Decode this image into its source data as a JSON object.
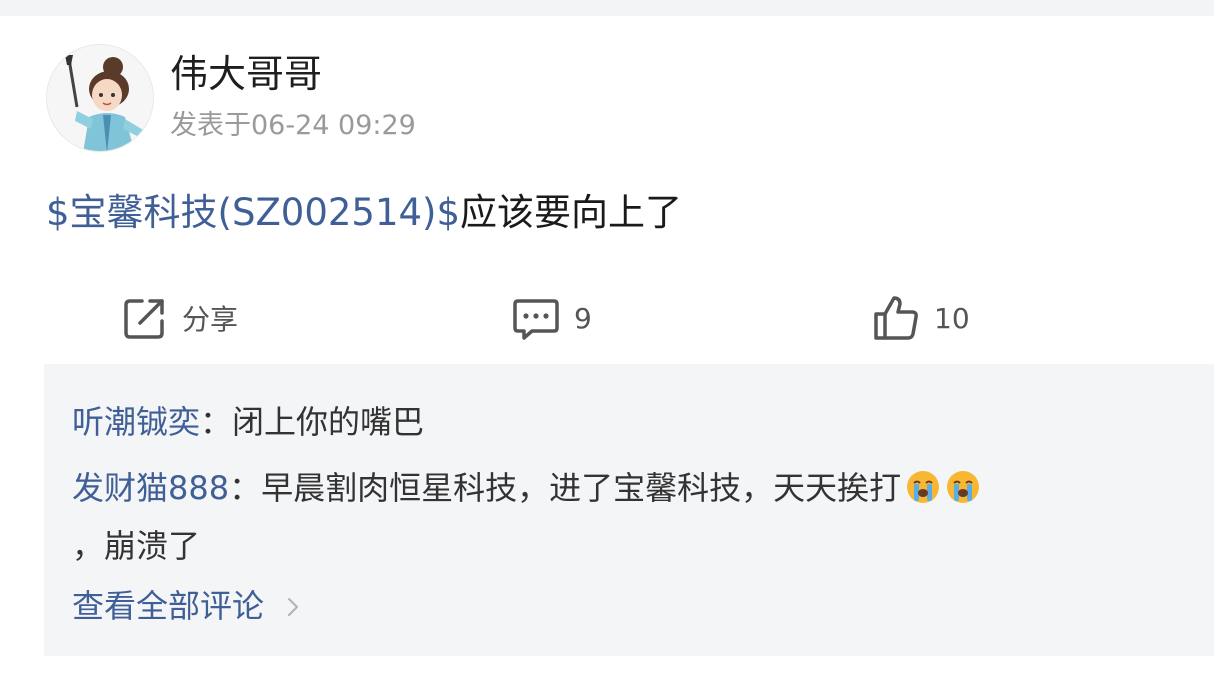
{
  "post": {
    "username": "伟大哥哥",
    "meta_prefix": "发表于",
    "timestamp": "06-24 09:29",
    "stock_link": "$宝馨科技(SZ002514)$",
    "content": "应该要向上了"
  },
  "actions": {
    "share_label": "分享",
    "comment_count": "9",
    "like_count": "10"
  },
  "comments": {
    "items": [
      {
        "author": "听潮铖奕",
        "separator": "：",
        "text": "闭上你的嘴巴"
      },
      {
        "author": "发财猫888",
        "separator": "：",
        "text": "早晨割肉恒星科技，进了宝馨科技，天天挨打",
        "text_cont": "，崩溃了"
      }
    ],
    "view_all_label": "查看全部评论"
  },
  "colors": {
    "link": "#3f5f96",
    "muted": "#9a9a9a",
    "comment_bg": "#f4f5f7"
  }
}
